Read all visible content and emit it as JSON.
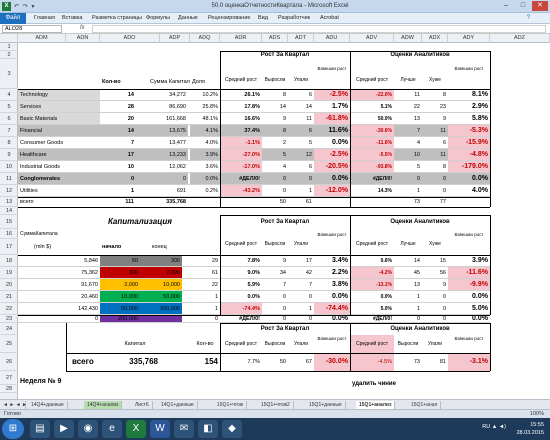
{
  "window": {
    "title": "50.0 оценкаОтчетностиКвартала - Microsoft Excel",
    "app_icon": "X",
    "quick_access": "↶ ↷ ▾"
  },
  "ribbon": {
    "file_tab": "Файл",
    "tabs": [
      "Главная",
      "Вставка",
      "Разметка страницы",
      "Формулы",
      "Данные",
      "Рецензирование",
      "Вид",
      "Разработчик",
      "Acrobat"
    ],
    "help_icon": "?"
  },
  "formula_bar": {
    "name_box": "ALO28",
    "fx": "fx",
    "value": ""
  },
  "columns": [
    "ADM",
    "ADN",
    "ADO",
    "ADP",
    "ADQ",
    "ADR",
    "ADS",
    "ADT",
    "ADU",
    "ADV",
    "ADW",
    "ADX",
    "ADY",
    "ADZ"
  ],
  "rows": [
    "1",
    "2",
    "3",
    "4",
    "5",
    "6",
    "7",
    "8",
    "9",
    "10",
    "11",
    "12",
    "13",
    "14",
    "15",
    "16",
    "17",
    "18",
    "19",
    "20",
    "21",
    "22",
    "23",
    "24",
    "25",
    "26",
    "27",
    "28"
  ],
  "t1": {
    "hdr_growth": "Рост За Квартал",
    "hdr_analysts": "Оценки Аналитиков",
    "col_count": "Кол-во",
    "col_cap": "Сумма Капитал",
    "col_share": "Доля",
    "col_avg": "Средний рост",
    "col_up": "Выросли",
    "col_down": "Упали",
    "col_wavg": "Взвешан рост",
    "col_a_avg": "Средний рост",
    "col_better": "Лучше",
    "col_worse": "Хуже",
    "col_a_wavg": "Взвешан рост",
    "rows": [
      {
        "name": "Technology",
        "count": "14",
        "cap": "34,272",
        "share": "10.2%",
        "avg": "26.1%",
        "up": "8",
        "down": "6",
        "wavg": "-2.5%",
        "a_avg": "-22.0%",
        "better": "11",
        "worse": "8",
        "a_wavg": "8.1%"
      },
      {
        "name": "Services",
        "count": "28",
        "cap": "86,690",
        "share": "25.8%",
        "avg": "17.8%",
        "up": "14",
        "down": "14",
        "wavg": "1.7%",
        "a_avg": "5.1%",
        "better": "22",
        "worse": "23",
        "a_wavg": "2.9%"
      },
      {
        "name": "Basic Materials",
        "count": "20",
        "cap": "161,668",
        "share": "48.1%",
        "avg": "16.6%",
        "up": "9",
        "down": "11",
        "wavg": "-61.8%",
        "a_avg": "50.0%",
        "better": "13",
        "worse": "9",
        "a_wavg": "5.8%"
      },
      {
        "name": "Financial",
        "count": "14",
        "cap": "13,675",
        "share": "4.1%",
        "avg": "37.4%",
        "up": "8",
        "down": "6",
        "wavg": "11.6%",
        "a_avg": "-30.6%",
        "better": "7",
        "worse": "11",
        "a_wavg": "-5.3%"
      },
      {
        "name": "Consumer Goods",
        "count": "7",
        "cap": "13,477",
        "share": "4.0%",
        "avg": "-1.1%",
        "up": "2",
        "down": "5",
        "wavg": "0.0%",
        "a_avg": "-11.6%",
        "better": "4",
        "worse": "6",
        "a_wavg": "-15.9%"
      },
      {
        "name": "Healthcare",
        "count": "17",
        "cap": "13,233",
        "share": "3.9%",
        "avg": "-27.0%",
        "up": "5",
        "down": "12",
        "wavg": "-2.5%",
        "a_avg": "-5.5%",
        "better": "10",
        "worse": "11",
        "a_wavg": "-4.8%"
      },
      {
        "name": "Industrial Goods",
        "count": "10",
        "cap": "12,062",
        "share": "3.6%",
        "avg": "-17.0%",
        "up": "4",
        "down": "6",
        "wavg": "-20.5%",
        "a_avg": "-93.8%",
        "better": "5",
        "worse": "8",
        "a_wavg": "-179.0%"
      },
      {
        "name": "Conglomerates",
        "count": "0",
        "cap": "0",
        "share": "0.0%",
        "avg": "#ДЕЛ/0!",
        "up": "0",
        "down": "0",
        "wavg": "0.0%",
        "a_avg": "#ДЕЛ/0!",
        "better": "0",
        "worse": "0",
        "a_wavg": "0.0%"
      },
      {
        "name": "Utilities",
        "count": "1",
        "cap": "691",
        "share": "0.2%",
        "avg": "-43.2%",
        "up": "0",
        "down": "1",
        "wavg": "-12.0%",
        "a_avg": "14.3%",
        "better": "1",
        "worse": "0",
        "a_wavg": "4.0%"
      }
    ],
    "total": {
      "name": "всего",
      "count": "111",
      "cap": "335,768",
      "up": "50",
      "down": "61",
      "better": "73",
      "worse": "77"
    }
  },
  "t2": {
    "title": "Капитализация",
    "hdr_growth": "Рост За Квартал",
    "hdr_analysts": "Оценки Аналитиков",
    "cap_label": "СуммаКапитала",
    "mln_label": "(mln $)",
    "col_start": "начало",
    "col_end": "конец",
    "col_avg": "Средний рост",
    "col_up": "Выросли",
    "col_down": "Упали",
    "col_wavg": "Взвешан рост",
    "col_a_avg": "Средний рост",
    "col_better": "Лучше",
    "col_worse": "Хуже",
    "col_a_wavg": "Взвешан рост",
    "rows": [
      {
        "sum": "5,846",
        "start": "50",
        "end": "300",
        "n": "29",
        "avg": "7.8%",
        "up": "9",
        "down": "17",
        "wavg": "3.4%",
        "a_avg": "0.6%",
        "better": "14",
        "worse": "15",
        "a_wavg": "3.9%"
      },
      {
        "sum": "75,362",
        "start": "300",
        "end": "2,000",
        "n": "61",
        "avg": "9.0%",
        "up": "34",
        "down": "42",
        "wavg": "2.2%",
        "a_avg": "-4.2%",
        "better": "45",
        "worse": "56",
        "a_wavg": "-11.6%"
      },
      {
        "sum": "91,670",
        "start": "2,000",
        "end": "10,000",
        "n": "22",
        "avg": "5.9%",
        "up": "7",
        "down": "7",
        "wavg": "3.8%",
        "a_avg": "-13.1%",
        "better": "13",
        "worse": "9",
        "a_wavg": "-9.9%"
      },
      {
        "sum": "20,460",
        "start": "10,000",
        "end": "50,000",
        "n": "1",
        "avg": "0.0%",
        "up": "0",
        "down": "0",
        "wavg": "0.0%",
        "a_avg": "0.0%",
        "better": "1",
        "worse": "0",
        "a_wavg": "0.0%"
      },
      {
        "sum": "142,430",
        "start": "50,000",
        "end": "200,000",
        "n": "1",
        "avg": "-74.4%",
        "up": "0",
        "down": "1",
        "wavg": "-74.4%",
        "a_avg": "5.0%",
        "better": "1",
        "worse": "0",
        "a_wavg": "5.0%"
      },
      {
        "sum": "0",
        "start": "200,000",
        "end": "",
        "n": "0",
        "avg": "#ДЕЛ/0!",
        "up": "0",
        "down": "0",
        "wavg": "0.0%",
        "a_avg": "#ДЕЛ/0!",
        "better": "0",
        "worse": "0",
        "a_wavg": "0.0%"
      }
    ],
    "band_colors": [
      "#808080",
      "#c00000",
      "#ffc000",
      "#00b050",
      "#0070c0",
      "#7030a0"
    ]
  },
  "t3": {
    "hdr_growth": "Рост За Квартал",
    "hdr_analysts": "Оценки Аналитиков",
    "col_cap": "Капитал",
    "col_count": "Кол-во",
    "col_avg": "Средний рост",
    "col_up": "Выросли",
    "col_down": "Упали",
    "col_wavg": "Взвешан рост",
    "col_a_avg": "Средний рост",
    "col_better": "Выросли",
    "col_worse": "Упали",
    "col_a_wavg": "Взвешан рост",
    "total": {
      "name": "всего",
      "cap": "335,768",
      "count": "154",
      "avg": "7.7%",
      "up": "50",
      "down": "67",
      "wavg": "-30.0%",
      "a_avg": "-4.5%",
      "better": "73",
      "worse": "81",
      "a_wavg": "-3.1%"
    }
  },
  "week": "Неделя № 9",
  "bottom_partial": "удалить чиние",
  "sheets": [
    "14Q4+данные",
    "14Q4+анализ",
    "Лист6",
    "14Q1+данные",
    "15Q1+чтож",
    "15Q1+чтож2",
    "15Q1+данные",
    "15Q1+анализ",
    "15Q1+анал"
  ],
  "active_sheet": "15Q1+анализ",
  "status": {
    "ready": "Готово",
    "zoom": "100%"
  },
  "taskbar": {
    "apps": [
      "folder-icon",
      "media-icon",
      "chrome-icon",
      "ie-icon",
      "excel-icon",
      "word-icon",
      "mail-icon",
      "explorer-icon",
      "misc-icon"
    ],
    "tray": "RU ▲ ◄)",
    "time": "15:55",
    "date": "28.03.2015"
  }
}
